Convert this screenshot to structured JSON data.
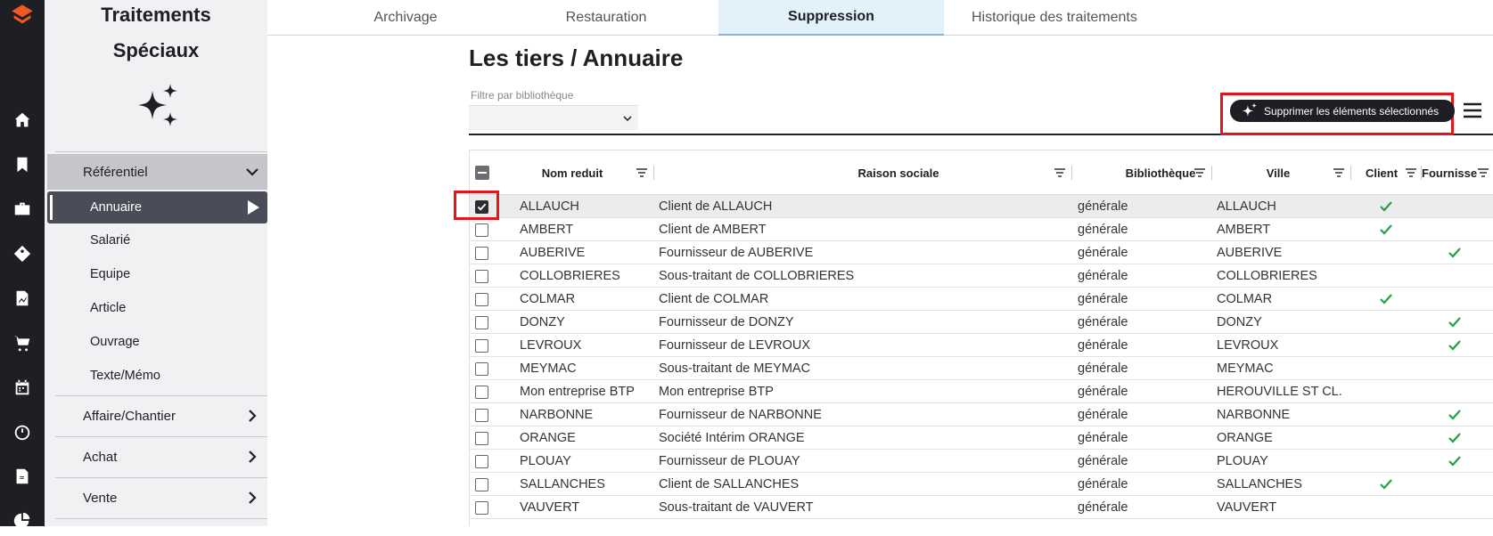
{
  "rail": {
    "icons": [
      "app-logo-icon",
      "home-icon",
      "bookmark-icon",
      "briefcase-icon",
      "price-tag-icon",
      "document-chart-icon",
      "cart-icon",
      "calendar-icon",
      "timer-icon",
      "euro-document-icon",
      "pie-chart-icon"
    ]
  },
  "sidebar": {
    "title_line1": "Traitements",
    "title_line2": "Spéciaux",
    "groups": {
      "referentiel": "Référentiel",
      "affaire": "Affaire/Chantier",
      "achat": "Achat",
      "vente": "Vente"
    },
    "items": [
      "Annuaire",
      "Salarié",
      "Equipe",
      "Article",
      "Ouvrage",
      "Texte/Mémo"
    ]
  },
  "tabs": [
    "Archivage",
    "Restauration",
    "Suppression",
    "Historique des traitements"
  ],
  "active_tab": "Suppression",
  "main": {
    "heading": "Les tiers / Annuaire",
    "filter_label": "Filtre par bibliothèque",
    "filter_value": "",
    "delete_button": "Supprimer les éléments sélectionnés"
  },
  "table": {
    "headers": {
      "nom": "Nom reduit",
      "raison": "Raison sociale",
      "biblio": "Bibliothèque",
      "ville": "Ville",
      "client": "Client",
      "fournisseur": "Fournisseur"
    },
    "rows": [
      {
        "nom": "ALLAUCH",
        "raison": "Client de ALLAUCH",
        "biblio": "générale",
        "ville": "ALLAUCH",
        "client": true,
        "fournisseur": false,
        "checked": true
      },
      {
        "nom": "AMBERT",
        "raison": "Client de AMBERT",
        "biblio": "générale",
        "ville": "AMBERT",
        "client": true,
        "fournisseur": false,
        "checked": false
      },
      {
        "nom": "AUBERIVE",
        "raison": "Fournisseur de AUBERIVE",
        "biblio": "générale",
        "ville": "AUBERIVE",
        "client": false,
        "fournisseur": true,
        "checked": false
      },
      {
        "nom": "COLLOBRIERES",
        "raison": "Sous-traitant de COLLOBRIERES",
        "biblio": "générale",
        "ville": "COLLOBRIERES",
        "client": false,
        "fournisseur": false,
        "checked": false
      },
      {
        "nom": "COLMAR",
        "raison": "Client de COLMAR",
        "biblio": "générale",
        "ville": "COLMAR",
        "client": true,
        "fournisseur": false,
        "checked": false
      },
      {
        "nom": "DONZY",
        "raison": "Fournisseur de DONZY",
        "biblio": "générale",
        "ville": "DONZY",
        "client": false,
        "fournisseur": true,
        "checked": false
      },
      {
        "nom": "LEVROUX",
        "raison": "Fournisseur de LEVROUX",
        "biblio": "générale",
        "ville": "LEVROUX",
        "client": false,
        "fournisseur": true,
        "checked": false
      },
      {
        "nom": "MEYMAC",
        "raison": "Sous-traitant de MEYMAC",
        "biblio": "générale",
        "ville": "MEYMAC",
        "client": false,
        "fournisseur": false,
        "checked": false
      },
      {
        "nom": "Mon entreprise BTP",
        "raison": "Mon entreprise BTP",
        "biblio": "générale",
        "ville": "HEROUVILLE ST CL...",
        "client": false,
        "fournisseur": false,
        "checked": false
      },
      {
        "nom": "NARBONNE",
        "raison": "Fournisseur de NARBONNE",
        "biblio": "générale",
        "ville": "NARBONNE",
        "client": false,
        "fournisseur": true,
        "checked": false
      },
      {
        "nom": "ORANGE",
        "raison": "Société Intérim ORANGE",
        "biblio": "générale",
        "ville": "ORANGE",
        "client": false,
        "fournisseur": true,
        "checked": false
      },
      {
        "nom": "PLOUAY",
        "raison": "Fournisseur de PLOUAY",
        "biblio": "générale",
        "ville": "PLOUAY",
        "client": false,
        "fournisseur": true,
        "checked": false
      },
      {
        "nom": "SALLANCHES",
        "raison": "Client de SALLANCHES",
        "biblio": "générale",
        "ville": "SALLANCHES",
        "client": true,
        "fournisseur": false,
        "checked": false
      },
      {
        "nom": "VAUVERT",
        "raison": "Sous-traitant de VAUVERT",
        "biblio": "générale",
        "ville": "VAUVERT",
        "client": false,
        "fournisseur": false,
        "checked": false
      }
    ]
  },
  "colors": {
    "rail": "#1e1f24",
    "sidebar": "#f1f1f3",
    "active_item": "#4a4c57",
    "active_tab": "#e3f1fb",
    "check_green": "#22a04a",
    "highlight_red": "#e3161b",
    "brand_orange": "#f15a22"
  }
}
